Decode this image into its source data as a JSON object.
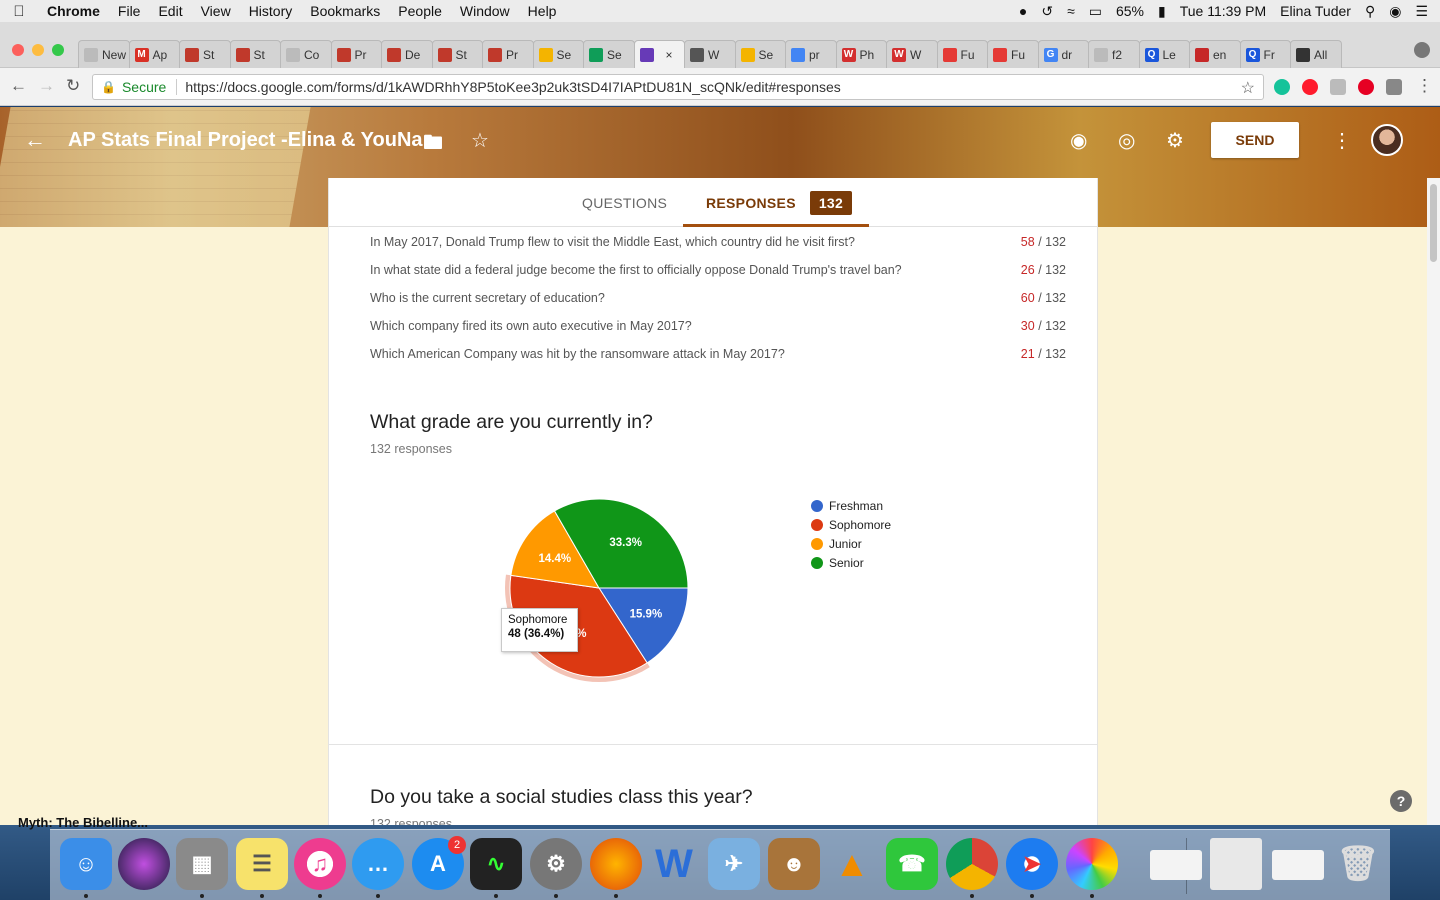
{
  "menubar": {
    "app": "Chrome",
    "items": [
      "File",
      "Edit",
      "View",
      "History",
      "Bookmarks",
      "People",
      "Window",
      "Help"
    ],
    "battery": "65%",
    "clock": "Tue 11:39 PM",
    "user": "Elina Tuder"
  },
  "tabs": [
    {
      "label": "New T",
      "fav_color": "#bbbbbb",
      "fav_text": ""
    },
    {
      "label": "Ap",
      "fav_color": "#d93025",
      "fav_text": "M"
    },
    {
      "label": "St",
      "fav_color": "#c0392b",
      "fav_text": ""
    },
    {
      "label": "St",
      "fav_color": "#c0392b",
      "fav_text": ""
    },
    {
      "label": "Co",
      "fav_color": "#bbbbbb",
      "fav_text": ""
    },
    {
      "label": "Pr",
      "fav_color": "#c0392b",
      "fav_text": ""
    },
    {
      "label": "De",
      "fav_color": "#c0392b",
      "fav_text": ""
    },
    {
      "label": "St",
      "fav_color": "#c0392b",
      "fav_text": ""
    },
    {
      "label": "Pr",
      "fav_color": "#c0392b",
      "fav_text": ""
    },
    {
      "label": "Se",
      "fav_color": "#f4b400",
      "fav_text": ""
    },
    {
      "label": "Se",
      "fav_color": "#0f9d58",
      "fav_text": ""
    },
    {
      "label": "",
      "fav_color": "#673ab7",
      "fav_text": "",
      "active": true
    },
    {
      "label": "W",
      "fav_color": "#555555",
      "fav_text": ""
    },
    {
      "label": "Se",
      "fav_color": "#f4b400",
      "fav_text": ""
    },
    {
      "label": "pr",
      "fav_color": "#4285f4",
      "fav_text": ""
    },
    {
      "label": "Ph",
      "fav_color": "#d32f2f",
      "fav_text": "W"
    },
    {
      "label": "W",
      "fav_color": "#d32f2f",
      "fav_text": "W"
    },
    {
      "label": "Fu",
      "fav_color": "#e53935",
      "fav_text": ""
    },
    {
      "label": "Fu",
      "fav_color": "#e53935",
      "fav_text": ""
    },
    {
      "label": "dr",
      "fav_color": "#4285f4",
      "fav_text": "G"
    },
    {
      "label": "f2",
      "fav_color": "#bbbbbb",
      "fav_text": ""
    },
    {
      "label": "Le",
      "fav_color": "#1a56db",
      "fav_text": "Q"
    },
    {
      "label": "en",
      "fav_color": "#c62828",
      "fav_text": ""
    },
    {
      "label": "Fr",
      "fav_color": "#1a56db",
      "fav_text": "Q"
    },
    {
      "label": "All",
      "fav_color": "#333333",
      "fav_text": ""
    }
  ],
  "address": {
    "secure_label": "Secure",
    "url": "https://docs.google.com/forms/d/1kAWDRhhY8P5toKee3p2uk3tSD4I7IAPtDU81N_scQNk/edit#responses"
  },
  "form": {
    "title": "AP Stats Final Project -Elina & YouNa",
    "send_label": "SEND",
    "tab_questions": "QUESTIONS",
    "tab_responses": "RESPONSES",
    "response_count": "132"
  },
  "questions": [
    {
      "text": "In May 2017, Donald Trump flew to visit the Middle East, which country did he visit first?",
      "correct": "58",
      "total": "/ 132"
    },
    {
      "text": "In what state did a federal judge become the first to officially oppose Donald Trump's travel ban?",
      "correct": "26",
      "total": "/ 132"
    },
    {
      "text": "Who is the current secretary of education?",
      "correct": "60",
      "total": "/ 132"
    },
    {
      "text": "Which company fired its own auto executive in May 2017?",
      "correct": "30",
      "total": "/ 132"
    },
    {
      "text": "Which American Company was hit by the ransomware attack in May 2017?",
      "correct": "21",
      "total": "/ 132"
    }
  ],
  "section1": {
    "title": "What grade are you currently in?",
    "subtitle": "132 responses"
  },
  "section2": {
    "title": "Do you take a social studies class this year?",
    "subtitle": "132 responses"
  },
  "tooltip": {
    "label": "Sophomore",
    "value": "48 (36.4%)"
  },
  "chart_data": {
    "type": "pie",
    "title": "What grade are you currently in?",
    "categories": [
      "Freshman",
      "Sophomore",
      "Junior",
      "Senior"
    ],
    "values": [
      21,
      48,
      19,
      44
    ],
    "percent_labels": [
      "15.9%",
      "36.4%",
      "14.4%",
      "33.3%"
    ],
    "colors": [
      "#3366cc",
      "#dc3912",
      "#ff9900",
      "#109618"
    ],
    "highlighted": "Sophomore",
    "legend_position": "right"
  },
  "stray_text": "Myth: The Bibelline..."
}
